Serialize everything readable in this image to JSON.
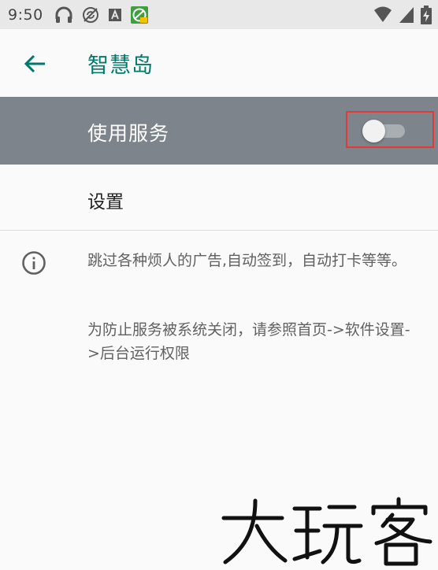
{
  "status_bar": {
    "time": "9:50",
    "icons_left": [
      "headphones-icon",
      "no-sync-icon",
      "text-a-icon",
      "app-notification-icon"
    ],
    "icons_right": [
      "wifi-icon",
      "cellular-signal-icon",
      "battery-charging-icon"
    ]
  },
  "app_bar": {
    "back_icon": "arrow-back-icon",
    "title": "智慧岛"
  },
  "master_switch": {
    "label": "使用服务",
    "enabled": false
  },
  "settings": {
    "label": "设置"
  },
  "info": {
    "icon": "info-icon",
    "description": "跳过各种烦人的广告,自动签到，自动打卡等等。",
    "note": "为防止服务被系统关闭，请参照首页->软件设置->后台运行权限"
  },
  "watermark": {
    "text": "大玩客"
  },
  "colors": {
    "accent": "#00796b",
    "master_bar": "#7d848c",
    "highlight_box": "#e53935",
    "status_bar": "#e8e8e8"
  }
}
